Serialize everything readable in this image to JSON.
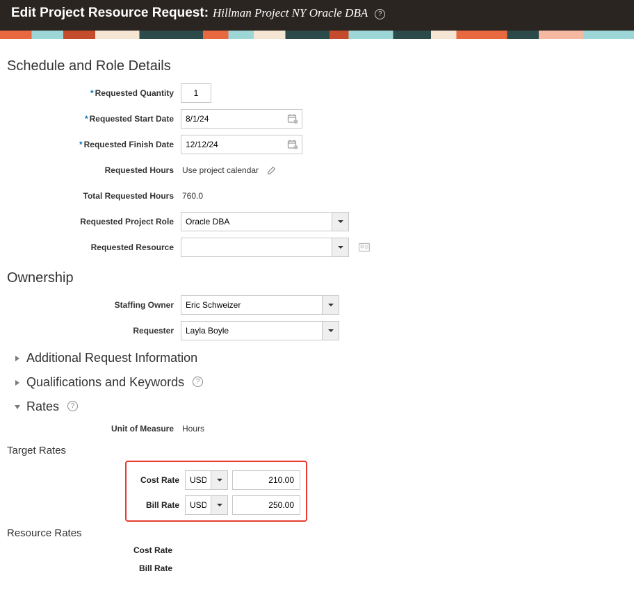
{
  "header": {
    "title_prefix": "Edit Project Resource Request:",
    "project_name": "Hillman Project NY Oracle DBA"
  },
  "sections": {
    "schedule": "Schedule and Role Details",
    "ownership": "Ownership",
    "additional": "Additional Request Information",
    "qualifications": "Qualifications and Keywords",
    "rates": "Rates"
  },
  "schedule": {
    "labels": {
      "requested_quantity": "Requested Quantity",
      "requested_start": "Requested Start Date",
      "requested_finish": "Requested Finish Date",
      "requested_hours": "Requested Hours",
      "total_requested_hours": "Total Requested Hours",
      "requested_role": "Requested Project Role",
      "requested_resource": "Requested Resource"
    },
    "values": {
      "requested_quantity": "1",
      "requested_start": "8/1/24",
      "requested_finish": "12/12/24",
      "requested_hours": "Use project calendar",
      "total_requested_hours": "760.0",
      "requested_role": "Oracle DBA",
      "requested_resource": ""
    }
  },
  "ownership": {
    "labels": {
      "staffing_owner": "Staffing Owner",
      "requester": "Requester"
    },
    "values": {
      "staffing_owner": "Eric Schweizer",
      "requester": "Layla Boyle"
    }
  },
  "rates": {
    "labels": {
      "uom": "Unit of Measure",
      "cost_rate": "Cost Rate",
      "bill_rate": "Bill Rate"
    },
    "values": {
      "uom": "Hours",
      "cost_currency": "USD",
      "cost_amount": "210.00",
      "bill_currency": "USD",
      "bill_amount": "250.00"
    },
    "subheads": {
      "target": "Target Rates",
      "resource": "Resource Rates"
    }
  }
}
